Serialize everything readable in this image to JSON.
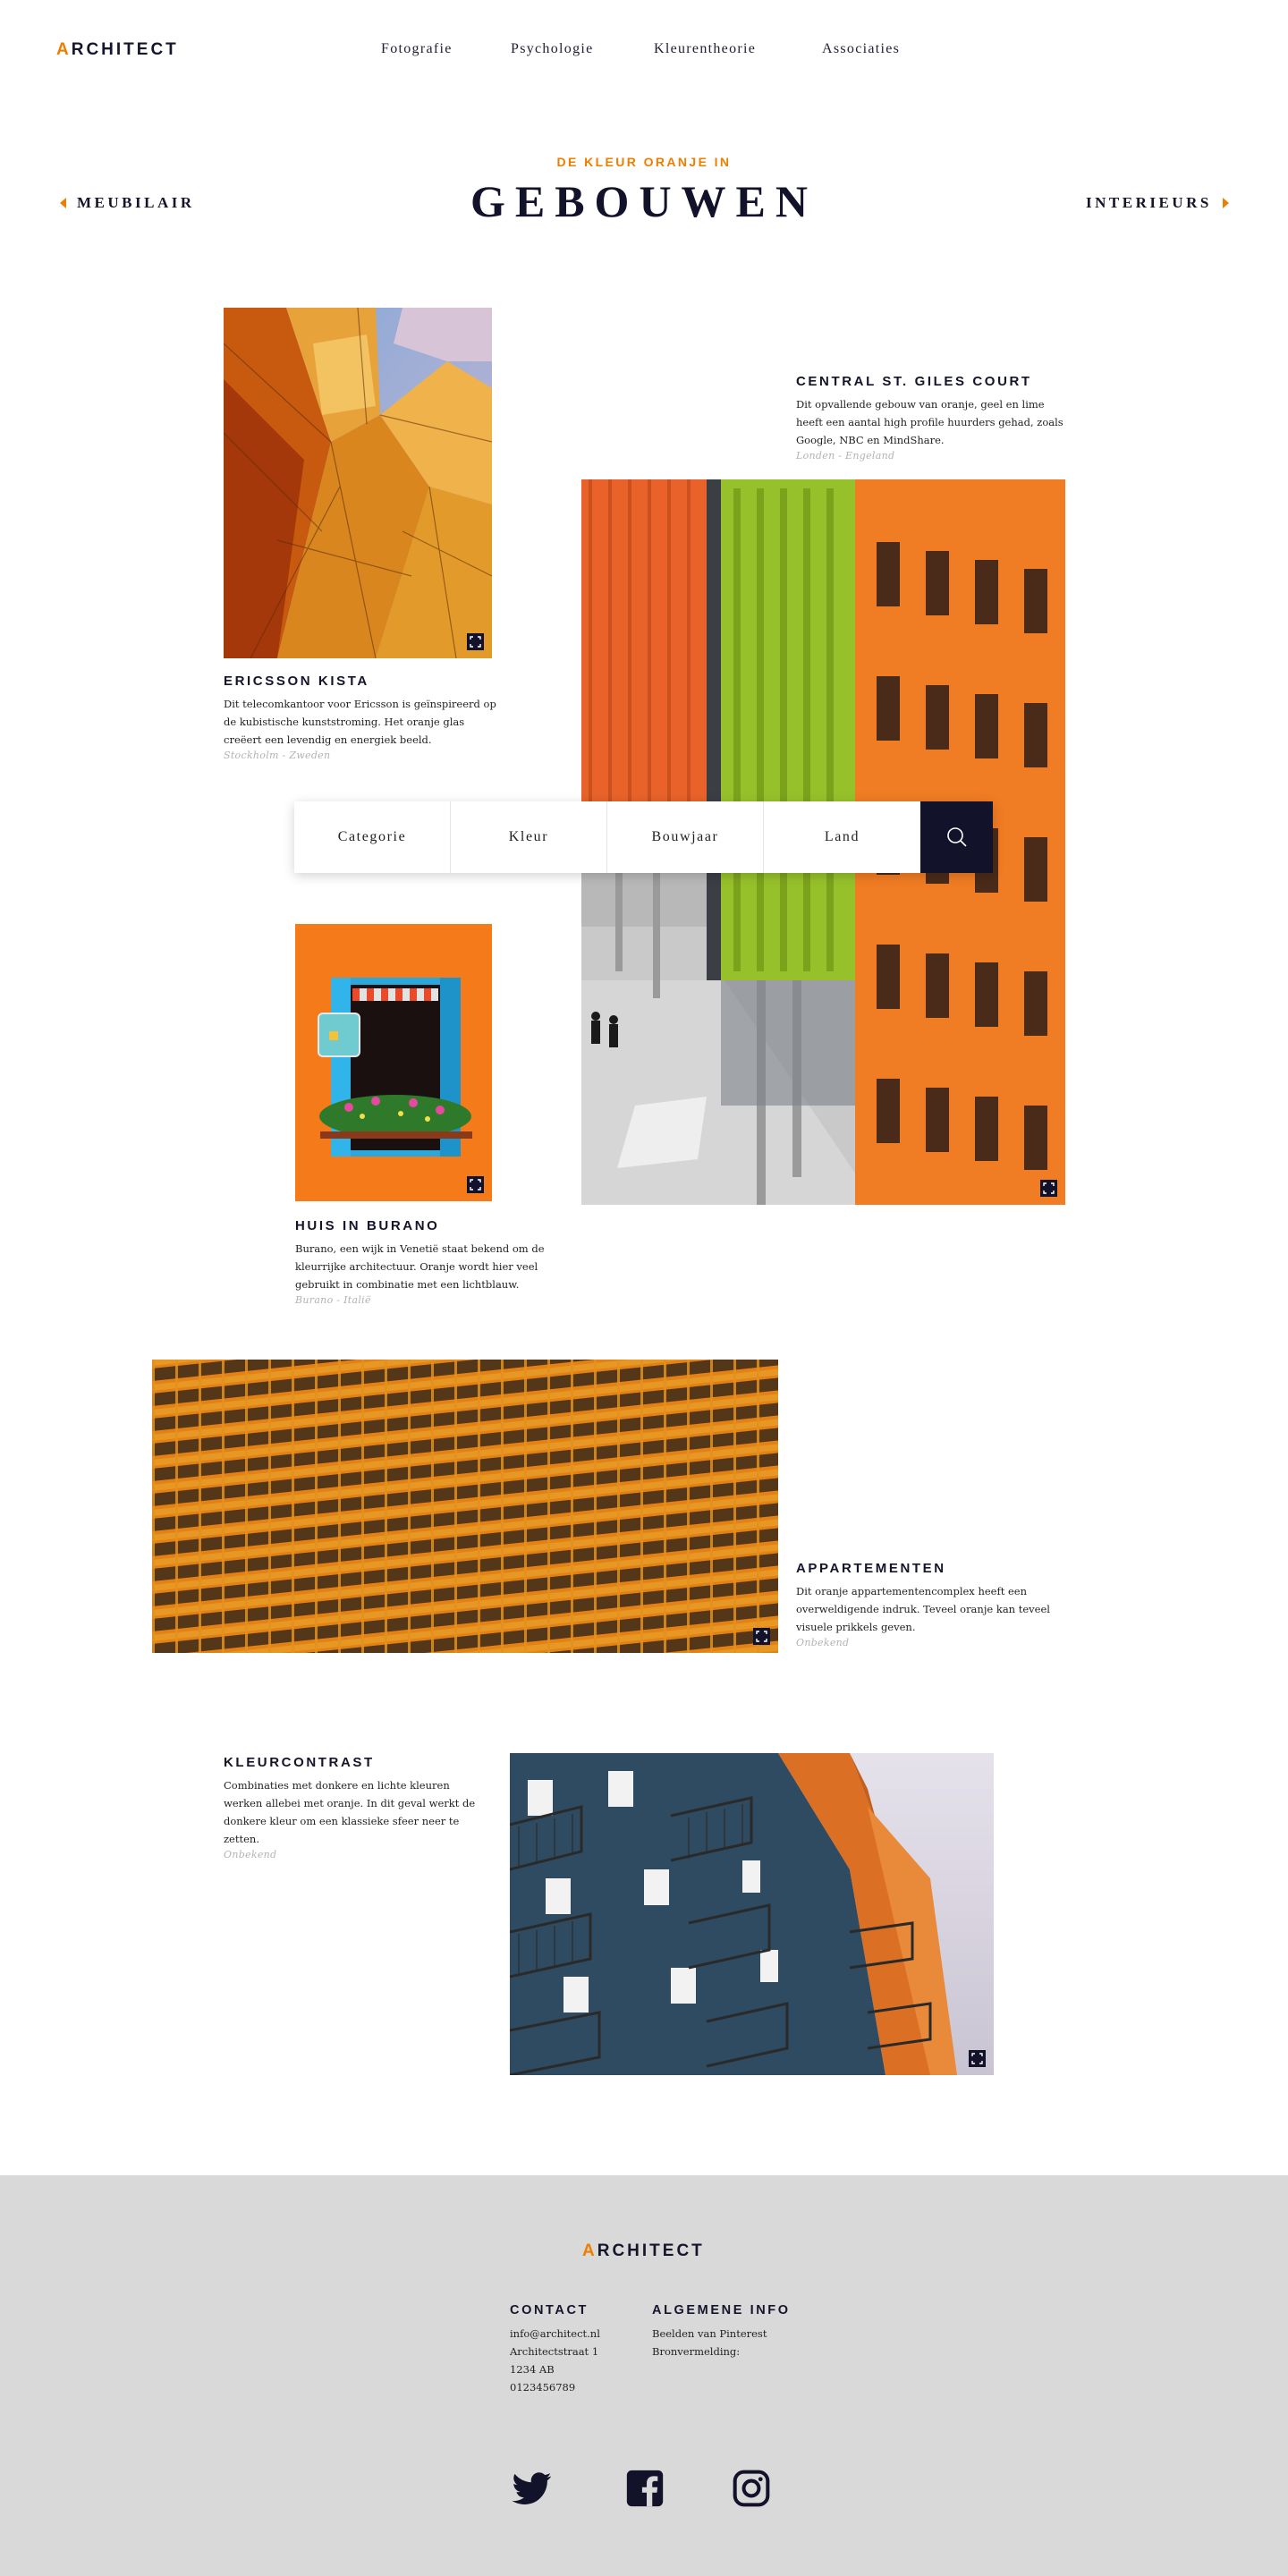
{
  "header": {
    "logo_first": "A",
    "logo_rest": "RCHITECT",
    "nav": [
      {
        "label": "Fotografie"
      },
      {
        "label": "Psychologie"
      },
      {
        "label": "Kleurentheorie"
      },
      {
        "label": "Associaties"
      }
    ]
  },
  "hero": {
    "eyebrow": "DE KLEUR ORANJE IN",
    "title": "GEBOUWEN",
    "prev_label": "MEUBILAIR",
    "next_label": "INTERIEURS"
  },
  "projects": [
    {
      "title": "ERICSSON KISTA",
      "text": "Dit telecomkantoor voor Ericsson is geïnspireerd op de kubistische kunststroming. Het oranje glas creëert een levendig en energiek beeld.",
      "location": "Stockholm - Zweden"
    },
    {
      "title": "CENTRAL ST. GILES COURT",
      "text": "Dit opvallende gebouw van oranje, geel en lime heeft een aantal high profile huurders gehad, zoals Google, NBC en MindShare.",
      "location": "Londen - Engeland"
    },
    {
      "title": "HUIS IN BURANO",
      "text": "Burano, een wijk in Venetië staat bekend om de kleurrijke architectuur. Oranje wordt hier veel gebruikt in combinatie met een lichtblauw.",
      "location": "Burano - Italië"
    },
    {
      "title": "APPARTEMENTEN",
      "text": "Dit oranje appartementencomplex heeft een overweldigende indruk. Teveel oranje kan teveel visuele prikkels geven.",
      "location": "Onbekend"
    },
    {
      "title": "KLEURCONTRAST",
      "text": "Combinaties met donkere en lichte kleuren werken allebei met oranje. In dit geval werkt de donkere kleur om een klassieke sfeer neer te zetten.",
      "location": "Onbekend"
    }
  ],
  "filter": {
    "items": [
      {
        "label": "Categorie"
      },
      {
        "label": "Kleur"
      },
      {
        "label": "Bouwjaar"
      },
      {
        "label": "Land"
      }
    ],
    "search_icon": "search-icon"
  },
  "footer": {
    "logo_first": "A",
    "logo_rest": "RCHITECT",
    "contact": {
      "heading": "CONTACT",
      "lines": [
        "info@architect.nl",
        "Architectstraat 1",
        "1234 AB",
        "0123456789"
      ]
    },
    "info": {
      "heading": "ALGEMENE INFO",
      "lines": [
        "Beelden van Pinterest",
        "Bronvermelding:"
      ]
    },
    "social": [
      "twitter-icon",
      "facebook-icon",
      "instagram-icon"
    ]
  },
  "colors": {
    "accent": "#ef7d00",
    "dark": "#12122a",
    "footer_bg": "#d9d9d9"
  }
}
